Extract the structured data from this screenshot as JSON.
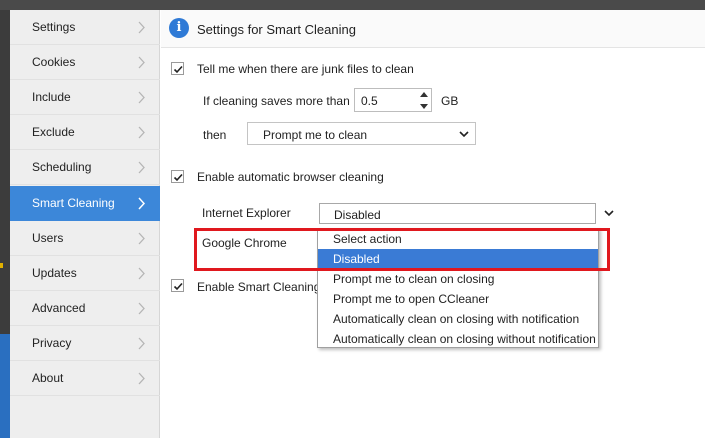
{
  "sidebar": {
    "items": [
      {
        "label": "Settings"
      },
      {
        "label": "Cookies"
      },
      {
        "label": "Include"
      },
      {
        "label": "Exclude"
      },
      {
        "label": "Scheduling"
      },
      {
        "label": "Smart Cleaning"
      },
      {
        "label": "Users"
      },
      {
        "label": "Updates"
      },
      {
        "label": "Advanced"
      },
      {
        "label": "Privacy"
      },
      {
        "label": "About"
      }
    ],
    "active": "Smart Cleaning"
  },
  "header": {
    "title": "Settings for Smart Cleaning"
  },
  "junk": {
    "label": "Tell me when there are junk files to clean",
    "checked": true,
    "threshold_label": "If cleaning saves more than",
    "threshold_value": "0.5",
    "threshold_unit": "GB",
    "then_label": "then",
    "then_value": "Prompt me to clean"
  },
  "browser": {
    "label": "Enable automatic browser cleaning",
    "checked": true,
    "ie_label": "Internet Explorer",
    "ie_value": "Disabled",
    "chrome_label": "Google Chrome",
    "options": [
      "Select action",
      "Disabled",
      "Prompt me to clean on closing",
      "Prompt me to open CCleaner",
      "Automatically clean on closing with notification",
      "Automatically clean on closing without notification"
    ],
    "selected_option": "Disabled"
  },
  "smart": {
    "label": "Enable Smart Cleaning",
    "checked": true
  },
  "colors": {
    "accent": "#3c87d9",
    "highlight": "#e0181e",
    "selection": "#3a7bd5"
  }
}
